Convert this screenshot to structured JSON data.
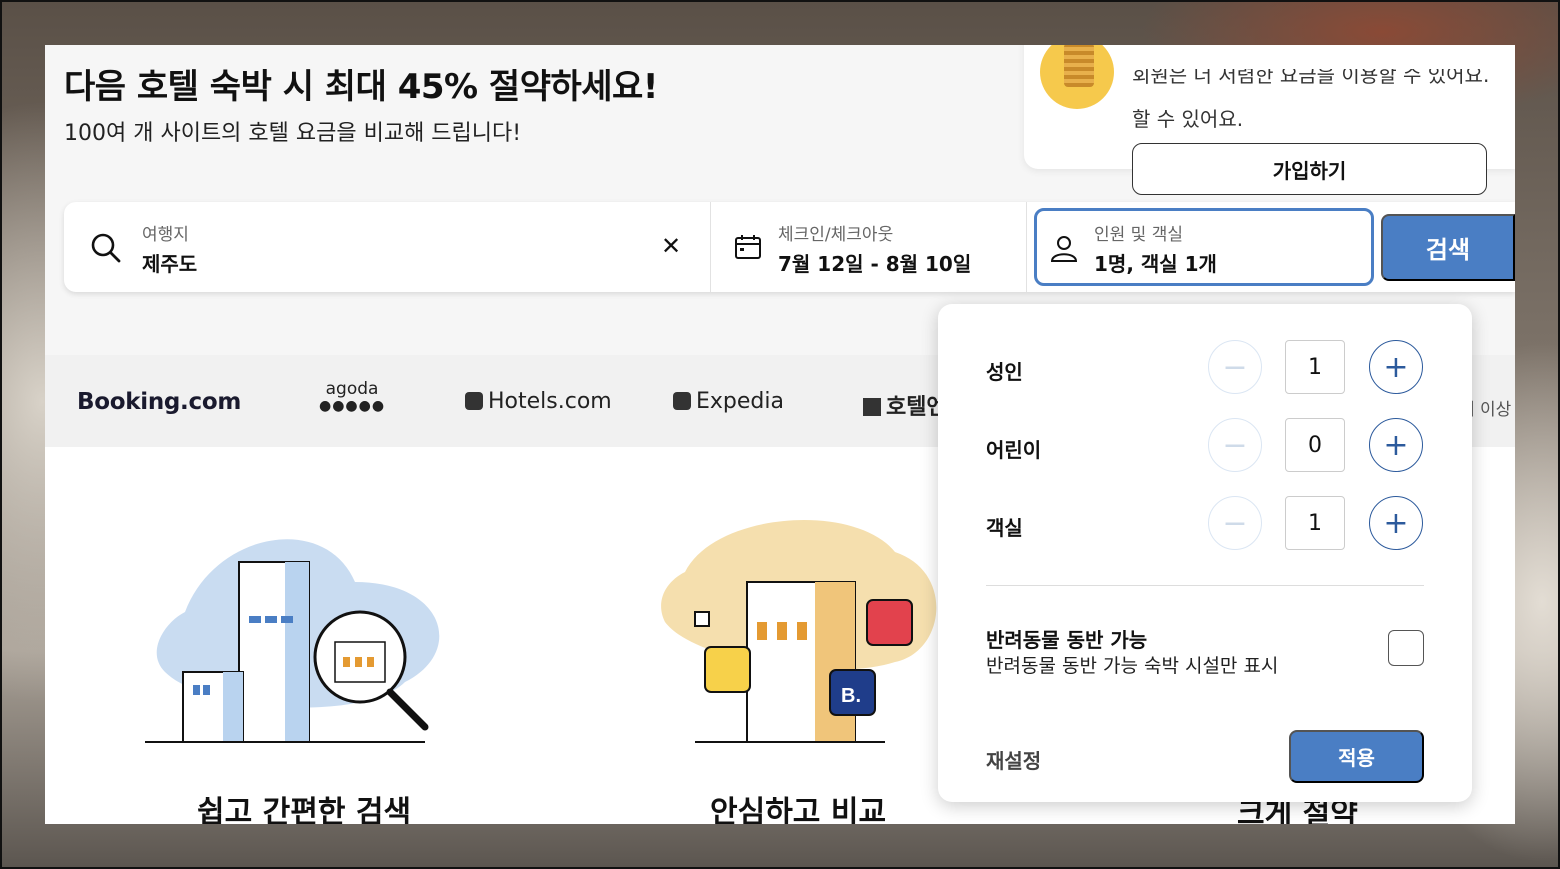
{
  "hero": {
    "title": "다음 호텔 숙박 시 최대 45% 절약하세요!",
    "subtitle": "100여 개 사이트의 호텔 요금을 비교해 드립니다!"
  },
  "promo": {
    "text_line_top": "회원은 더 저렴한 요금을 이용할 수 있어요.",
    "text": "할 수 있어요.",
    "signup_label": "가입하기"
  },
  "search": {
    "destination_label": "여행지",
    "destination_value": "제주도",
    "clear_icon": "close-icon",
    "dates_label": "체크인/체크아웃",
    "dates_value": "7월 12일 - 8월 10일",
    "guests_label": "인원 및 객실",
    "guests_value": "1명, 객실 1개",
    "search_label": "검색"
  },
  "brands": {
    "booking": "Booking.com",
    "agoda": "agoda",
    "hotels": "Hotels.com",
    "expedia": "Expedia",
    "hotelsn": "호텔엔",
    "more": "개 이상"
  },
  "features": {
    "item1": "쉽고 간편한 검색",
    "item2": "안심하고 비교",
    "item3": "크게 절약"
  },
  "guests_panel": {
    "rows": [
      {
        "label": "성인",
        "value": "1"
      },
      {
        "label": "어린이",
        "value": "0"
      },
      {
        "label": "객실",
        "value": "1"
      }
    ],
    "minus_symbol": "−",
    "plus_symbol": "+",
    "pet_title": "반려동물 동반 가능",
    "pet_subtitle": "반려동물 동반 가능 숙박 시설만 표시",
    "pet_checked": false,
    "reset_label": "재설정",
    "apply_label": "적용"
  },
  "colors": {
    "accent": "#4a7ec4",
    "active_border": "#4a7ec4",
    "plus_color": "#2c5a9c"
  }
}
